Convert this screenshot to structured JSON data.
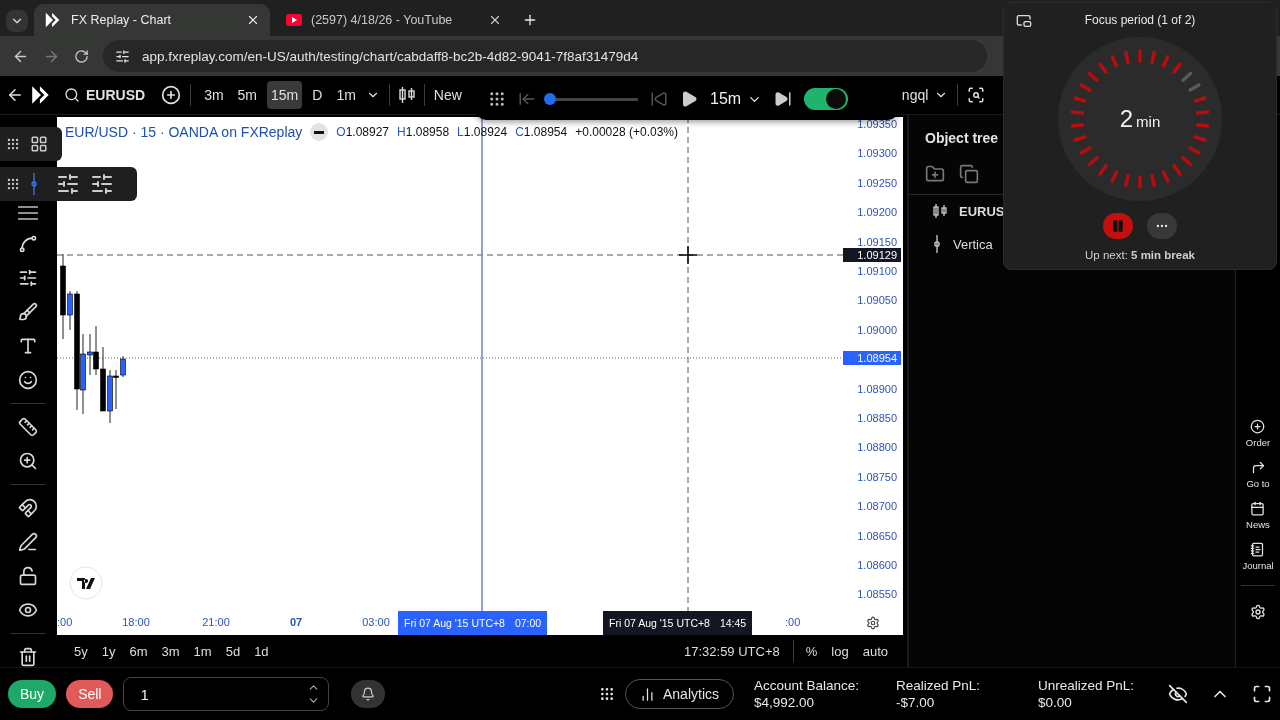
{
  "browser": {
    "tabs": [
      {
        "kind": "fxreplay",
        "title": "FX Replay - Chart",
        "selected": true
      },
      {
        "kind": "youtube",
        "title": "(2597) 4/18/26 - YouTube",
        "selected": false
      }
    ],
    "url": "app.fxreplay.com/en-US/auth/testing/chart/cabdaff8-bc2b-4d82-9041-7f8af31479d4"
  },
  "toolbar": {
    "symbol": "EURUSD",
    "intervals": [
      {
        "label": "3m",
        "selected": false
      },
      {
        "label": "5m",
        "selected": false
      },
      {
        "label": "15m",
        "selected": true
      },
      {
        "label": "D",
        "selected": false
      },
      {
        "label": "1m",
        "selected": false
      }
    ],
    "new_label": "New",
    "layout_name": "ngql"
  },
  "playback": {
    "interval": "15m",
    "level": 0.02,
    "on": true
  },
  "legend": {
    "title": "EUR/USD · 15 · OANDA on FXReplay",
    "ohlc": [
      {
        "key": "O",
        "value": "1.08927"
      },
      {
        "key": "H",
        "value": "1.08958"
      },
      {
        "key": "L",
        "value": "1.08924"
      },
      {
        "key": "C",
        "value": "1.08954"
      }
    ],
    "change": "+0.00028 (+0.03%)"
  },
  "price_axis": {
    "labels": [
      {
        "kind": "tick",
        "text": "1.09350"
      },
      {
        "kind": "tick",
        "text": "1.09300"
      },
      {
        "kind": "tick",
        "text": "1.09250"
      },
      {
        "kind": "tick",
        "text": "1.09200"
      },
      {
        "kind": "tick",
        "text": "1.09150"
      },
      {
        "kind": "tick",
        "text": "1.09100"
      },
      {
        "kind": "tick",
        "text": "1.09050"
      },
      {
        "kind": "tick",
        "text": "1.09000"
      },
      {
        "kind": "last_price",
        "text": "1.08954"
      },
      {
        "kind": "tick",
        "text": "1.08900"
      },
      {
        "kind": "tick",
        "text": "1.08850"
      },
      {
        "kind": "tick",
        "text": "1.08800"
      },
      {
        "kind": "tick",
        "text": "1.08750"
      },
      {
        "kind": "tick",
        "text": "1.08700"
      },
      {
        "kind": "tick",
        "text": "1.08650"
      },
      {
        "kind": "tick",
        "text": "1.08600"
      },
      {
        "kind": "tick",
        "text": "1.08550"
      }
    ],
    "crosshair_price": "1.09129"
  },
  "time_axis": {
    "ticks": [
      {
        "label": ":00",
        "kind": "time"
      },
      {
        "label": "18:00",
        "kind": "time"
      },
      {
        "label": "21:00",
        "kind": "time"
      },
      {
        "label": "07",
        "kind": "day"
      },
      {
        "label": "03:00",
        "kind": "time"
      }
    ],
    "replay_date": "Fri 07 Aug '15 UTC+8",
    "replay_time": "07:00",
    "crosshair_date": "Fri 07 Aug '15 UTC+8",
    "crosshair_time": "14:45",
    "trailing_tick": ":00"
  },
  "ranges": [
    "5y",
    "1y",
    "6m",
    "3m",
    "1m",
    "5d",
    "1d"
  ],
  "clock": "17:32:59 UTC+8",
  "scale_options": [
    "%",
    "log",
    "auto"
  ],
  "object_tree": {
    "title": "Object tree",
    "items": [
      {
        "kind": "series",
        "label": "EURUS"
      },
      {
        "kind": "drawing",
        "label": "Vertica"
      }
    ]
  },
  "rail": [
    {
      "kind": "order",
      "label": "Order"
    },
    {
      "kind": "goto",
      "label": "Go to"
    },
    {
      "kind": "news",
      "label": "News"
    },
    {
      "kind": "journal",
      "label": "Journal"
    }
  ],
  "trade": {
    "buy": "Buy",
    "sell": "Sell",
    "quantity": "1",
    "analytics": "Analytics",
    "stats": [
      {
        "label": "Account Balance:",
        "value": "$4,992.00"
      },
      {
        "label": "Realized PnL:",
        "value": "-$7.00"
      },
      {
        "label": "Unrealized PnL:",
        "value": "$0.00"
      }
    ]
  },
  "focus": {
    "title": "Focus period (1 of 2)",
    "minutes": "2",
    "unit": "min",
    "up_next": "Up next: **5 min break**"
  }
}
